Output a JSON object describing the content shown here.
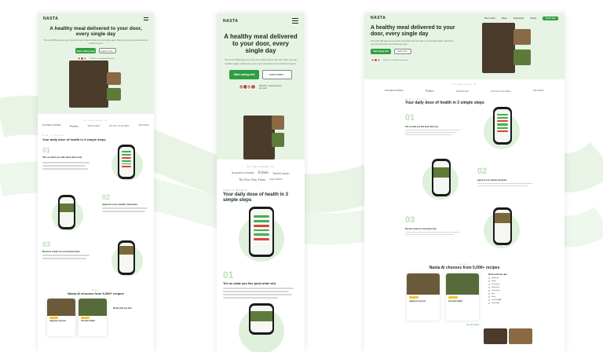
{
  "colors": {
    "accent": "#2f9e44",
    "hero_bg": "#e6f3e5",
    "soft_green": "#dff0dc"
  },
  "brand_logo": "NASTA",
  "hero": {
    "title": "A healthy meal delivered to your door, every single day",
    "subtitle": "The smart 365-days-per-year food subscription that will make you eat healthy again. Tailored to your personal tastes and nutritional needs.",
    "cta_primary": "Start eating well",
    "cta_secondary": "Learn more ↓",
    "meals_served": "250,000+ meals delivered last year!"
  },
  "featured": {
    "label": "AS FEATURED IN",
    "brands": [
      "BUSINESS INSIDER",
      "Forbes",
      "TechCrunch",
      "The New York Times",
      "USA TODAY"
    ]
  },
  "how": {
    "label": "HOW IT WORKS",
    "title": "Your daily dose of health in 3 simple steps",
    "steps": [
      {
        "num": "01",
        "title": "Tell us what you like (and what not)"
      },
      {
        "num": "02",
        "title": "Approve your weekly meal plan"
      },
      {
        "num": "03",
        "title": "Receive meals at convenient time"
      }
    ]
  },
  "meals": {
    "label": "MEALS",
    "title": "Nasta AI chooses from 5,000+ recipes",
    "cards": [
      {
        "tag": "Vegetarian",
        "name": "Japanese Gyozas"
      },
      {
        "tag": "Paleo",
        "name": "Avocado Salad"
      }
    ],
    "diets_title": "Works with any diet:",
    "diets": [
      "Vegetarian",
      "Vegan",
      "Pescatarian",
      "Gluten-free",
      "Lactose-free",
      "Keto",
      "Paleo",
      "Low FODMAP",
      "Kid-friendly"
    ],
    "see_all": "See all recipes →"
  },
  "nav": {
    "links": [
      "How it works",
      "Meals",
      "Testimonials",
      "Pricing"
    ],
    "cta": "Try for free"
  }
}
